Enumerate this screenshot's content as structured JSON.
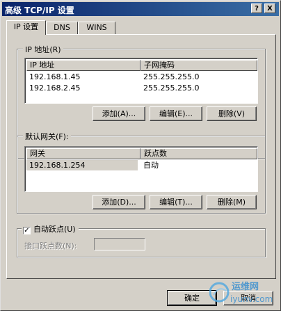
{
  "window": {
    "title": "高级 TCP/IP 设置",
    "help_label": "?",
    "close_label": "X"
  },
  "tabs": [
    {
      "label": "IP 设置",
      "active": true
    },
    {
      "label": "DNS",
      "active": false
    },
    {
      "label": "WINS",
      "active": false
    }
  ],
  "ip_group": {
    "legend": "IP 地址(R)",
    "columns": [
      "IP 地址",
      "子网掩码"
    ],
    "rows": [
      {
        "ip": "192.168.1.45",
        "mask": "255.255.255.0"
      },
      {
        "ip": "192.168.2.45",
        "mask": "255.255.255.0"
      }
    ],
    "add_label": "添加(A)...",
    "edit_label": "编辑(E)...",
    "delete_label": "删除(V)"
  },
  "gateway_group": {
    "legend": "默认网关(F):",
    "columns": [
      "网关",
      "跃点数"
    ],
    "rows": [
      {
        "gateway": "192.168.1.254",
        "metric": "自动"
      }
    ],
    "add_label": "添加(D)...",
    "edit_label": "编辑(T)...",
    "delete_label": "删除(M)"
  },
  "metric_group": {
    "auto_metric_label": "自动跃点(U)",
    "auto_metric_checked": true,
    "interface_metric_label": "接口跃点数(N):",
    "interface_metric_value": ""
  },
  "footer": {
    "ok_label": "确定",
    "cancel_label": "取消"
  },
  "watermark": {
    "text_cn": "运维网",
    "text_url": "iyunv.com"
  },
  "colors": {
    "title_start": "#0a246a",
    "title_end": "#3a6ea5",
    "face": "#d4d0c8"
  }
}
